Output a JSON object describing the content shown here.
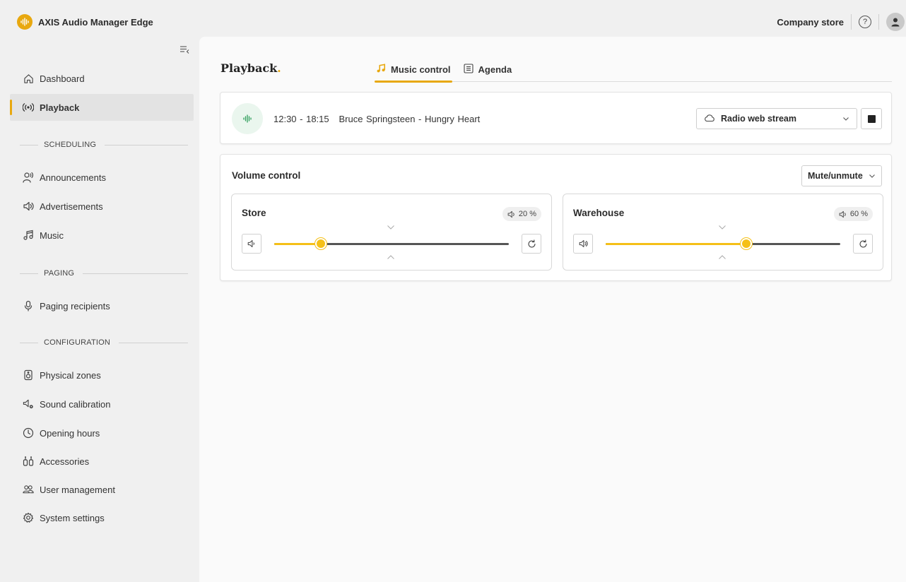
{
  "app": {
    "title": "AXIS Audio Manager Edge",
    "accent_color": "#e8a80f"
  },
  "topbar": {
    "site_name": "Company store",
    "help_icon": "help-circle-icon",
    "avatar_icon": "user-avatar-icon"
  },
  "sidebar": {
    "collapse_icon": "collapse-sidebar-icon",
    "items": [
      {
        "label": "Dashboard",
        "icon": "home-icon"
      },
      {
        "label": "Playback",
        "icon": "broadcast-icon",
        "active": true
      }
    ],
    "sections": [
      {
        "label": "SCHEDULING",
        "items": [
          {
            "label": "Announcements",
            "icon": "announcer-icon"
          },
          {
            "label": "Advertisements",
            "icon": "speaker-icon"
          },
          {
            "label": "Music",
            "icon": "music-note-icon"
          }
        ]
      },
      {
        "label": "PAGING",
        "items": [
          {
            "label": "Paging recipients",
            "icon": "microphone-icon"
          }
        ]
      },
      {
        "label": "CONFIGURATION",
        "items": [
          {
            "label": "Physical zones",
            "icon": "zone-speaker-icon"
          },
          {
            "label": "Sound calibration",
            "icon": "speaker-gear-icon"
          },
          {
            "label": "Opening hours",
            "icon": "clock-icon"
          },
          {
            "label": "Accessories",
            "icon": "accessories-icon"
          },
          {
            "label": "User management",
            "icon": "users-icon"
          },
          {
            "label": "System settings",
            "icon": "gear-icon"
          }
        ]
      }
    ]
  },
  "page": {
    "title": "Playback",
    "title_dot": ".",
    "tabs": [
      {
        "label": "Music control",
        "icon": "music-note-icon",
        "active": true
      },
      {
        "label": "Agenda",
        "icon": "list-icon",
        "active": false
      }
    ]
  },
  "now_playing": {
    "time": "12:30 - 18:15",
    "track": "Bruce Springsteen - Hungry Heart",
    "source": "Radio web stream",
    "source_icon": "cloud-icon",
    "stop_icon": "stop-icon",
    "playing_color": "#2e9e5b"
  },
  "volume": {
    "title": "Volume control",
    "mute_label": "Mute/unmute",
    "zones": [
      {
        "name": "Store",
        "level_label": "20 %",
        "level": 20
      },
      {
        "name": "Warehouse",
        "level_label": "60 %",
        "level": 60
      }
    ]
  }
}
